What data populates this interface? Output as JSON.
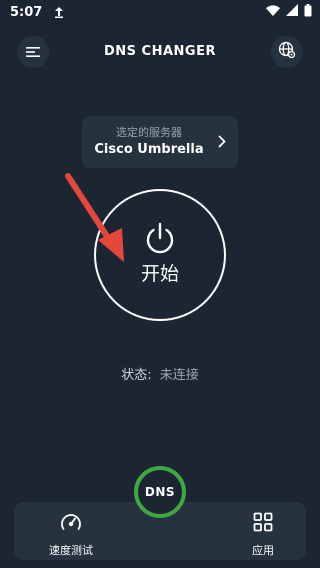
{
  "status_bar": {
    "time": "5:07",
    "icons": [
      "upload-arrow-icon",
      "wifi-icon",
      "cellular-signal-icon",
      "battery-icon"
    ]
  },
  "app_bar": {
    "title": "DNS CHANGER",
    "menu_icon": "hamburger-menu-icon",
    "globe_icon": "globe-settings-icon"
  },
  "server_card": {
    "caption": "选定的服务器",
    "name": "Cisco Umbrella",
    "chevron_icon": "chevron-right-icon"
  },
  "power_button": {
    "icon": "power-icon",
    "label": "开始"
  },
  "connection_status": {
    "label": "状态:",
    "value": "未连接"
  },
  "annotation": {
    "icon": "red-arrow",
    "color": "#e5483b"
  },
  "bottom_nav": {
    "speed_test": {
      "icon": "speedometer-icon",
      "label": "速度测试"
    },
    "apps": {
      "icon": "grid-icon",
      "label": "应用"
    },
    "fab_label": "DNS"
  },
  "colors": {
    "background": "#1c2632",
    "surface": "#27323f",
    "accent_green": "#3ea843",
    "annotation_red": "#e5483b",
    "muted_text": "#9aa5b1"
  }
}
